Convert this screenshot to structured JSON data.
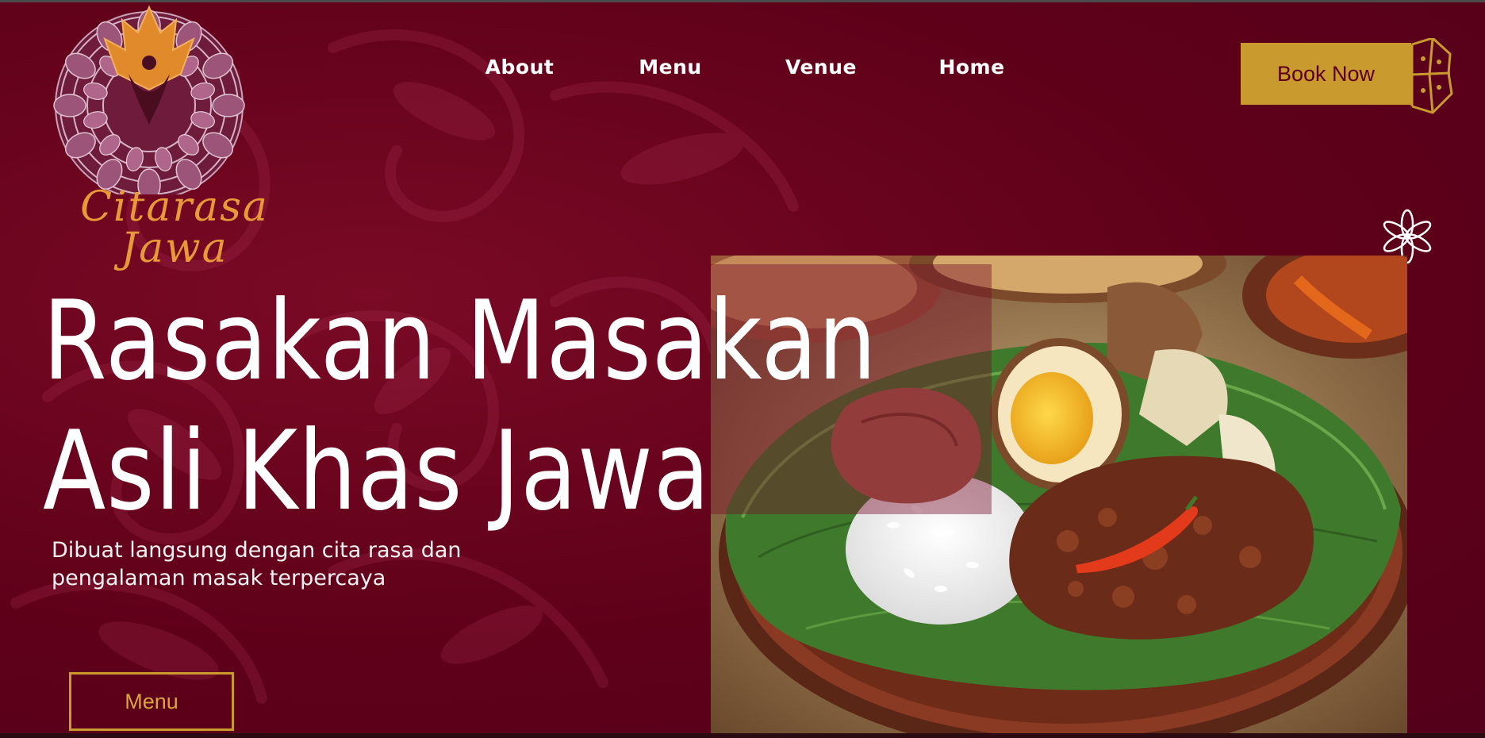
{
  "brand": {
    "name_line1": "Citarasa",
    "name_line2": "Jawa",
    "logo_icon": "mandala-wayang-icon"
  },
  "nav": {
    "items": [
      {
        "label": "About"
      },
      {
        "label": "Menu"
      },
      {
        "label": "Venue"
      },
      {
        "label": "Home"
      }
    ]
  },
  "book": {
    "label": "Book Now"
  },
  "hero": {
    "headline_line1": "Rasakan Masakan",
    "headline_line2": "Asli Khas Jawa",
    "subtext_line1": "Dibuat langsung dengan cita rasa dan",
    "subtext_line2": "pengalaman masak terpercaya",
    "cta_label": "Menu",
    "image_subject": "gudeg-plate-photo"
  },
  "colors": {
    "background": "#5c0019",
    "accent_gold": "#c99a2e",
    "logo_orange": "#e89a38",
    "text": "#ffffff"
  }
}
